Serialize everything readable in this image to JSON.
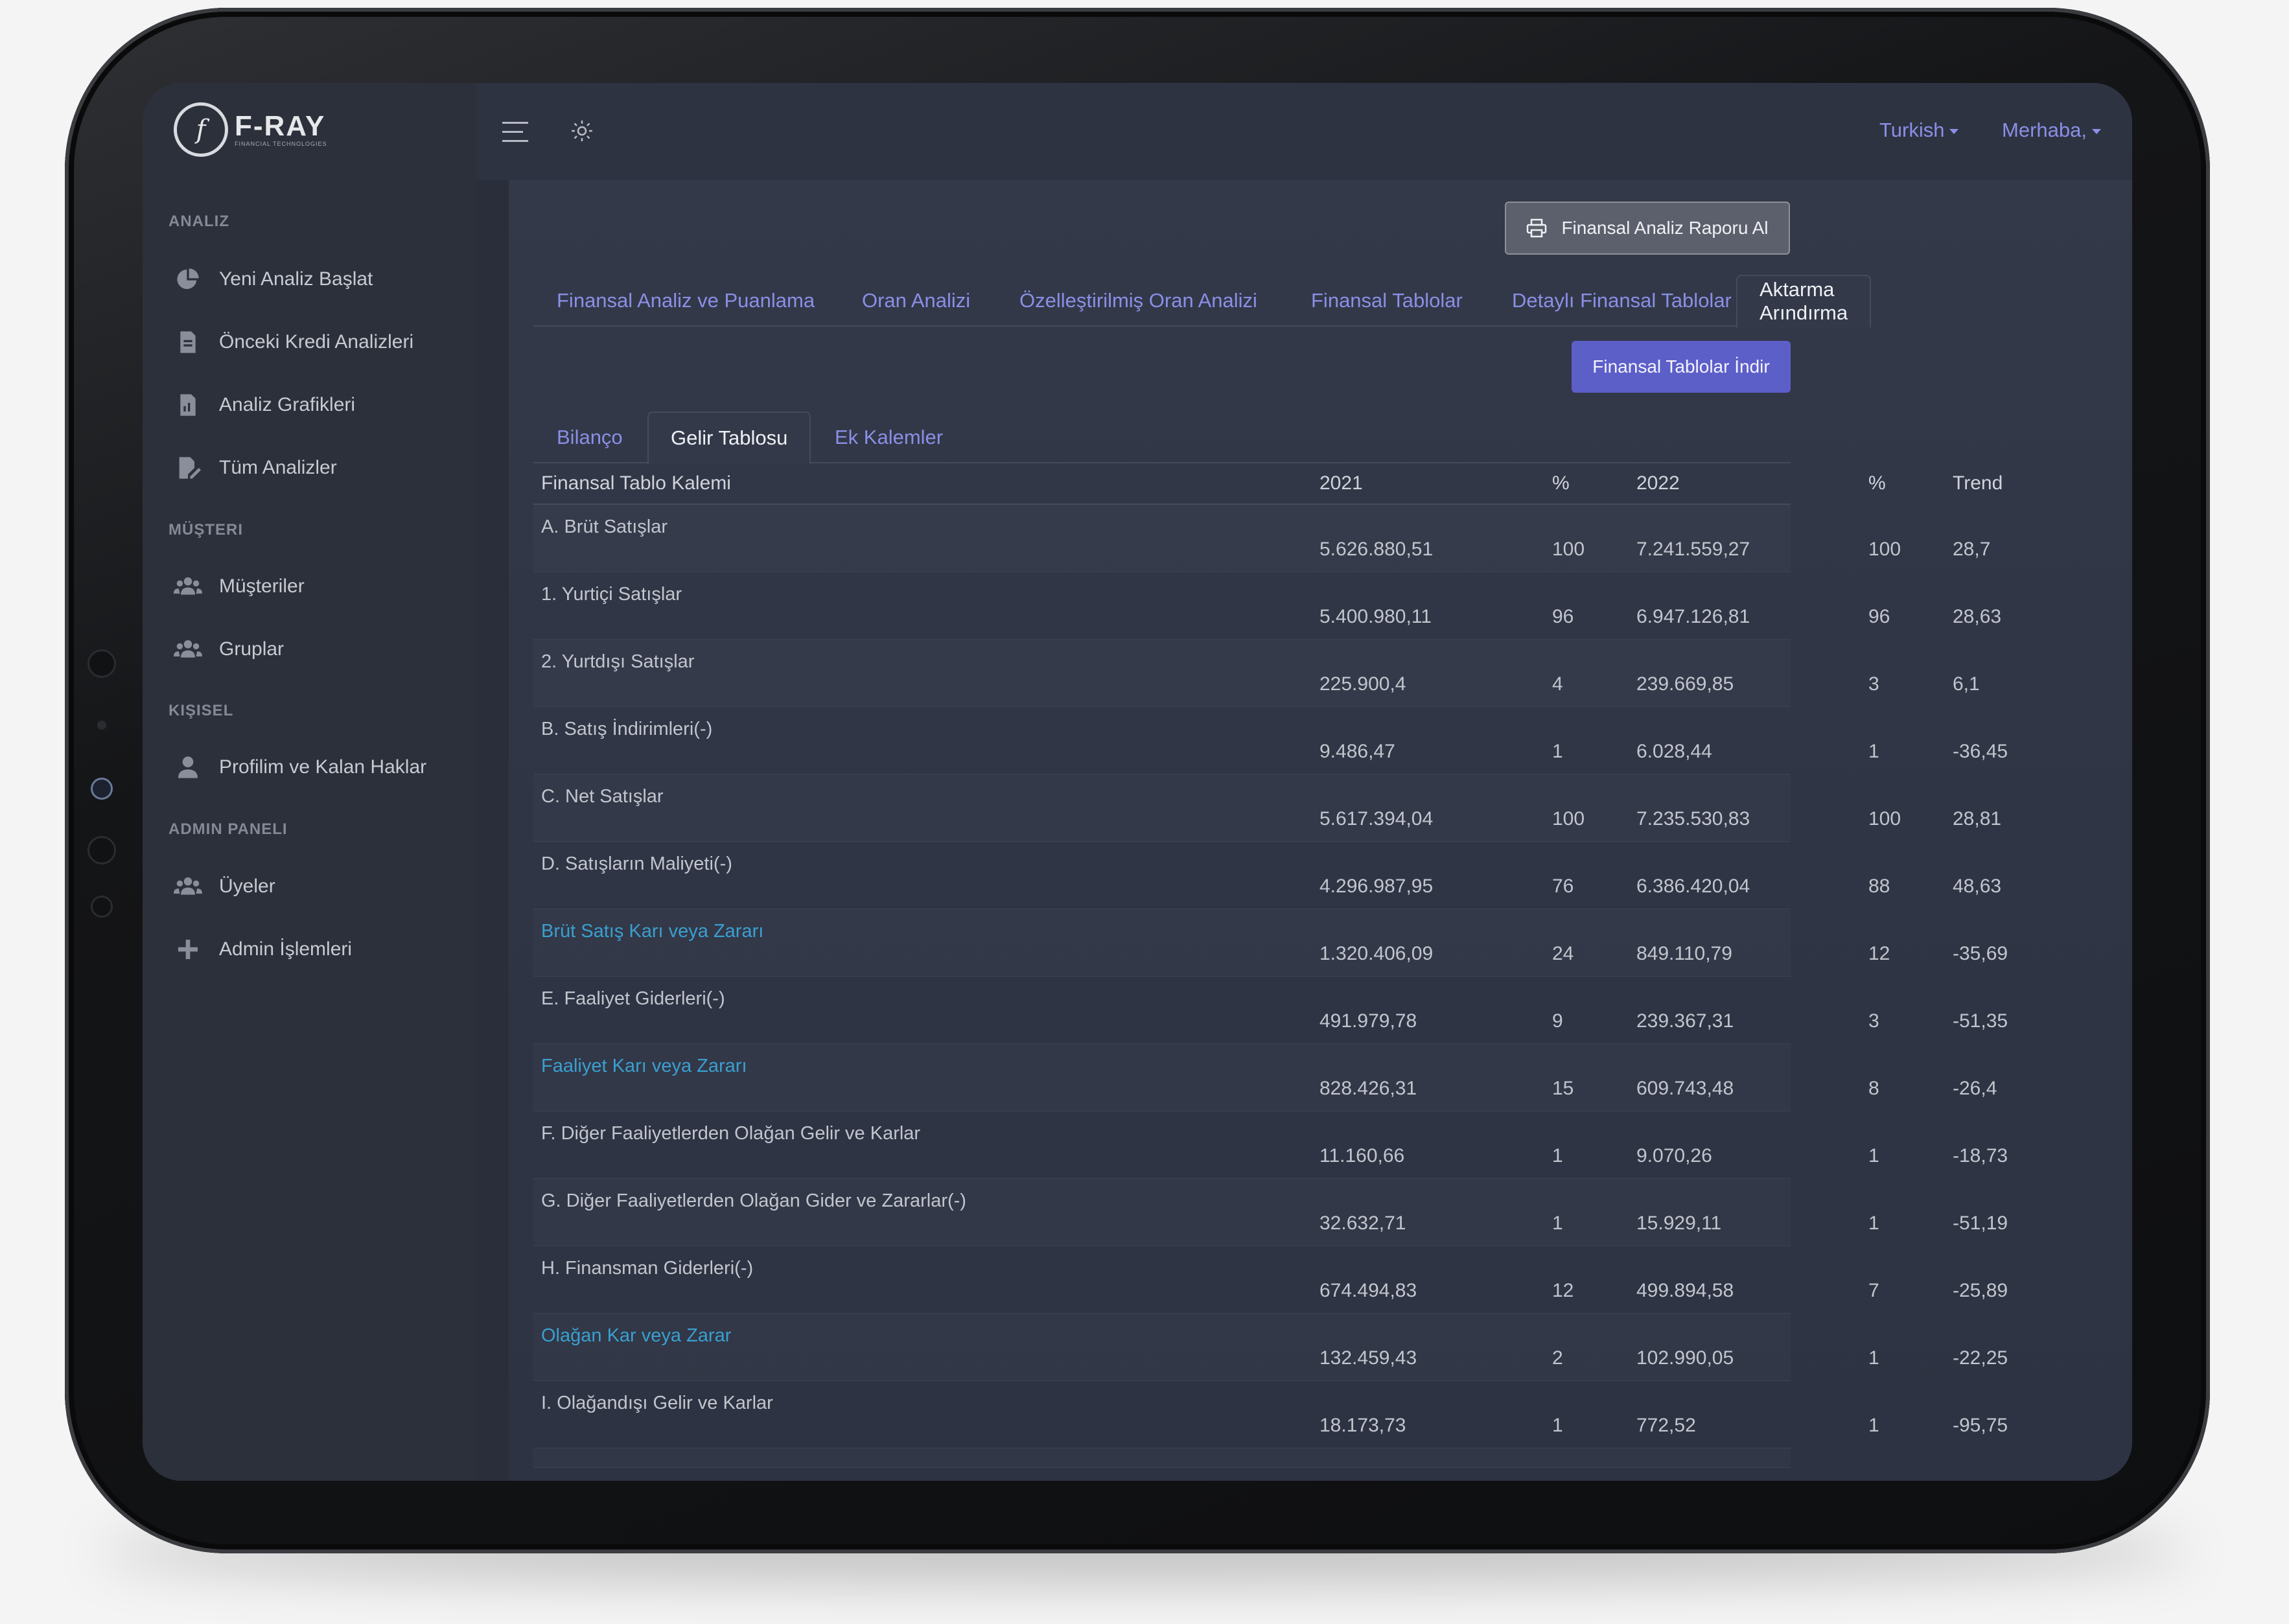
{
  "brand": {
    "mark": "f",
    "name": "F-RAY",
    "tagline": "FINANCIAL TECHNOLOGIES"
  },
  "sidebar": {
    "sections": [
      {
        "title": "ANALIZ",
        "items": [
          "Yeni Analiz Başlat",
          "Önceki Kredi Analizleri",
          "Analiz Grafikleri",
          "Tüm Analizler"
        ]
      },
      {
        "title": "MÜŞTERI",
        "items": [
          "Müşteriler",
          "Gruplar"
        ]
      },
      {
        "title": "KIŞISEL",
        "items": [
          "Profilim ve Kalan Haklar"
        ]
      },
      {
        "title": "ADMIN PANELI",
        "items": [
          "Üyeler",
          "Admin İşlemleri"
        ]
      }
    ]
  },
  "topbar": {
    "language": "Turkish",
    "greeting": "Merhaba,"
  },
  "actions": {
    "report": "Finansal Analiz Raporu Al",
    "download": "Finansal Tablolar İndir"
  },
  "main_tabs": [
    "Finansal Analiz ve Puanlama",
    "Oran Analizi",
    "Özelleştirilmiş Oran Analizi",
    "Finansal Tablolar",
    "Detaylı Finansal Tablolar",
    "Aktarma Arındırma"
  ],
  "main_tab_active": "Aktarma Arındırma",
  "sub_tabs": [
    "Bilanço",
    "Gelir Tablosu",
    "Ek Kalemler"
  ],
  "sub_tab_active": "Gelir Tablosu",
  "table": {
    "headers": [
      "Finansal Tablo Kalemi",
      "2021",
      "%",
      "2022",
      "%",
      "Trend"
    ],
    "rows": [
      {
        "label": "A. Brüt Satışlar",
        "v2021": "5.626.880,51",
        "p2021": "100",
        "v2022": "7.241.559,27",
        "p2022": "100",
        "trend": "28,7",
        "highlight": false
      },
      {
        "label": "1. Yurtiçi Satışlar",
        "v2021": "5.400.980,11",
        "p2021": "96",
        "v2022": "6.947.126,81",
        "p2022": "96",
        "trend": "28,63",
        "highlight": false
      },
      {
        "label": "2. Yurtdışı Satışlar",
        "v2021": "225.900,4",
        "p2021": "4",
        "v2022": "239.669,85",
        "p2022": "3",
        "trend": "6,1",
        "highlight": false
      },
      {
        "label": "B. Satış İndirimleri(-)",
        "v2021": "9.486,47",
        "p2021": "1",
        "v2022": "6.028,44",
        "p2022": "1",
        "trend": "-36,45",
        "highlight": false
      },
      {
        "label": "C. Net Satışlar",
        "v2021": "5.617.394,04",
        "p2021": "100",
        "v2022": "7.235.530,83",
        "p2022": "100",
        "trend": "28,81",
        "highlight": false
      },
      {
        "label": "D. Satışların Maliyeti(-)",
        "v2021": "4.296.987,95",
        "p2021": "76",
        "v2022": "6.386.420,04",
        "p2022": "88",
        "trend": "48,63",
        "highlight": false
      },
      {
        "label": "Brüt Satış Karı veya Zararı",
        "v2021": "1.320.406,09",
        "p2021": "24",
        "v2022": "849.110,79",
        "p2022": "12",
        "trend": "-35,69",
        "highlight": true
      },
      {
        "label": "E. Faaliyet Giderleri(-)",
        "v2021": "491.979,78",
        "p2021": "9",
        "v2022": "239.367,31",
        "p2022": "3",
        "trend": "-51,35",
        "highlight": false
      },
      {
        "label": "Faaliyet Karı veya Zararı",
        "v2021": "828.426,31",
        "p2021": "15",
        "v2022": "609.743,48",
        "p2022": "8",
        "trend": "-26,4",
        "highlight": true
      },
      {
        "label": "F. Diğer Faaliyetlerden Olağan Gelir ve Karlar",
        "v2021": "11.160,66",
        "p2021": "1",
        "v2022": "9.070,26",
        "p2022": "1",
        "trend": "-18,73",
        "highlight": false
      },
      {
        "label": "G. Diğer Faaliyetlerden Olağan Gider ve Zararlar(-)",
        "v2021": "32.632,71",
        "p2021": "1",
        "v2022": "15.929,11",
        "p2022": "1",
        "trend": "-51,19",
        "highlight": false
      },
      {
        "label": "H. Finansman Giderleri(-)",
        "v2021": "674.494,83",
        "p2021": "12",
        "v2022": "499.894,58",
        "p2022": "7",
        "trend": "-25,89",
        "highlight": false
      },
      {
        "label": "Olağan Kar veya Zarar",
        "v2021": "132.459,43",
        "p2021": "2",
        "v2022": "102.990,05",
        "p2022": "1",
        "trend": "-22,25",
        "highlight": true
      },
      {
        "label": "I. Olağandışı Gelir ve Karlar",
        "v2021": "18.173,73",
        "p2021": "1",
        "v2022": "772,52",
        "p2022": "1",
        "trend": "-95,75",
        "highlight": false
      }
    ]
  },
  "colors": {
    "accent": "#8a8fe6",
    "highlight": "#3a9fd0",
    "button": "#5d5fc8",
    "sidebar": "#2c303a"
  }
}
